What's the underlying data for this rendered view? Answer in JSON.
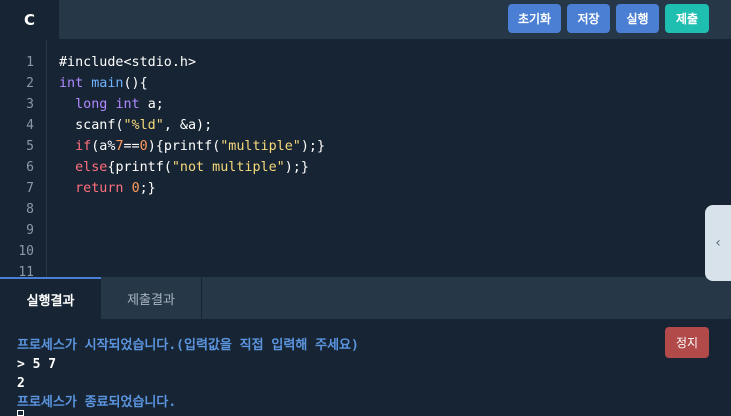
{
  "toolbar": {
    "language": "C",
    "buttons": {
      "reset": "초기화",
      "save": "저장",
      "run": "실행",
      "submit": "제출"
    }
  },
  "editor": {
    "line_numbers": [
      "1",
      "2",
      "3",
      "4",
      "5",
      "6",
      "7",
      "8",
      "9",
      "10",
      "11"
    ],
    "lines": [
      "#include<stdio.h>",
      "int main(){",
      "  long int a;",
      "  scanf(\"%ld\", &a);",
      "  if(a%7==0){printf(\"multiple\");}",
      "  else{printf(\"not multiple\");}",
      "  return 0;}",
      "",
      "",
      "",
      ""
    ],
    "tokens": {
      "l1": "#include<stdio.h>",
      "l2_type": "int",
      "l2_fn": "main",
      "l2_rest": "(){",
      "l3_type1": "long",
      "l3_type2": "int",
      "l3_rest": "a;",
      "l4_fn": "scanf",
      "l4_p1": "(",
      "l4_str": "\"%ld\"",
      "l4_rest": ", &a);",
      "l5_kw": "if",
      "l5_a": "(a%",
      "l5_n1": "7",
      "l5_b": "==",
      "l5_n2": "0",
      "l5_c": "){",
      "l5_fn": "printf",
      "l5_d": "(",
      "l5_str": "\"multiple\"",
      "l5_e": ");}",
      "l6_kw": "else",
      "l6_a": "{",
      "l6_fn": "printf",
      "l6_b": "(",
      "l6_str": "\"not multiple\"",
      "l6_c": ");}",
      "l7_kw": "return",
      "l7_n": "0",
      "l7_rest": ";}"
    },
    "collapse_handle_icon": "chevron-left-icon"
  },
  "result_tabs": {
    "active": "실행결과",
    "inactive": "제출결과"
  },
  "console": {
    "lines": [
      "프로세스가 시작되었습니다.(입력값을 직접 입력해 주세요)",
      "> 5 7",
      "2",
      "프로세스가 종료되었습니다."
    ],
    "stop_label": "정지"
  }
}
